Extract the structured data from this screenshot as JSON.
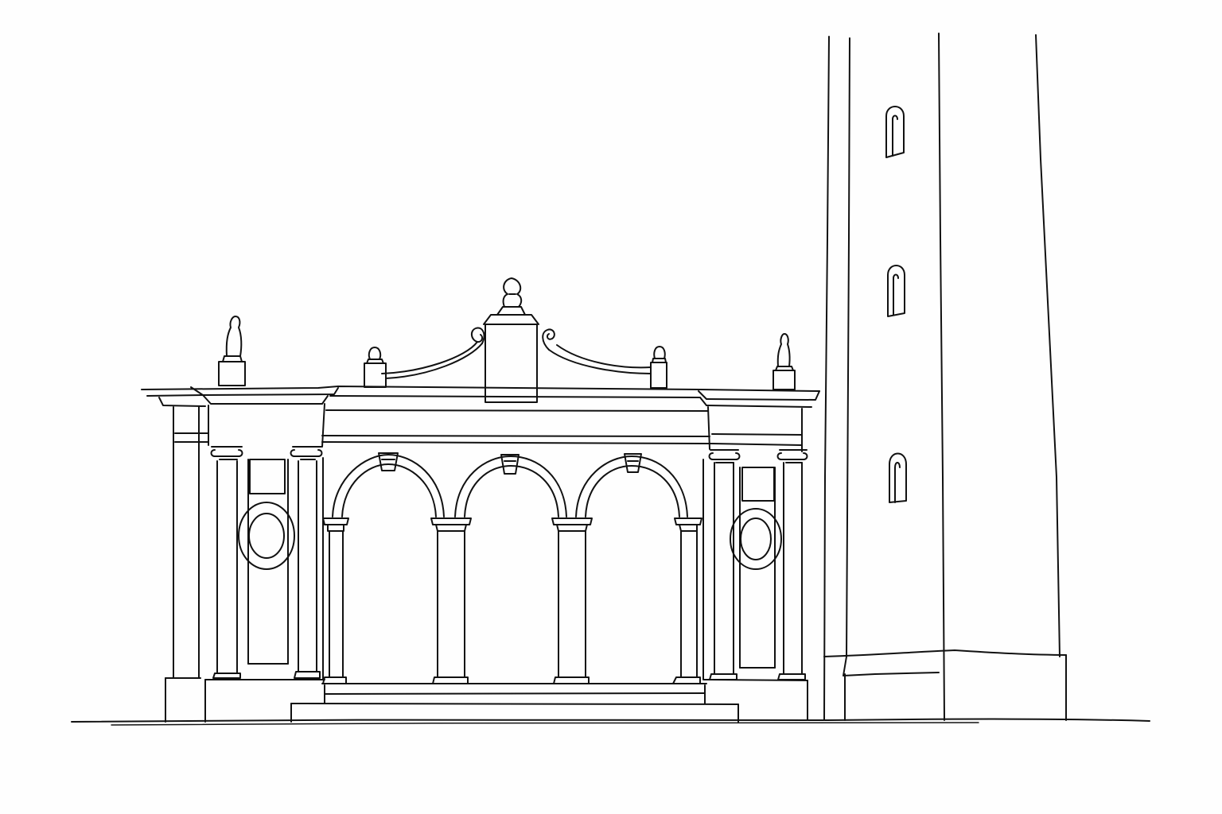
{
  "drawing": {
    "subject": "loggia-with-bell-tower",
    "medium": "pen-line-sketch",
    "background_color": "#fefefe",
    "line_color": "#111111"
  }
}
